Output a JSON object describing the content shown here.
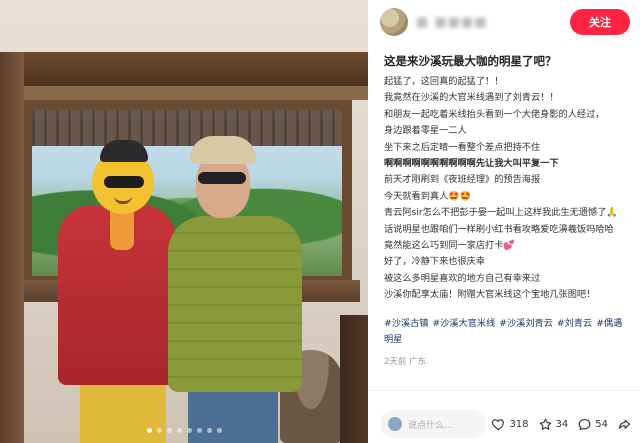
{
  "header": {
    "author_name": "■ ■■■■",
    "follow_label": "关注"
  },
  "post": {
    "title": "这是来沙溪玩最大咖的明星了吧？",
    "lines": [
      "起猛了，这回真的起猛了！！",
      "我竟然在沙溪的大官米线遇到了刘青云！！",
      "和朋友一起吃着米线抬头看到一个大佬身影的人经过，",
      "身边跟着零星一二人",
      "坐下来之后定睛一看整个差点把持不住",
      "啊啊啊啊啊啊啊啊啊啊先让我大叫平复一下",
      "前天才刚刷到《夜班经理》的预告海报",
      "今天就看到真人🤩🤩",
      "青云阿sir怎么不把彭于晏一起叫上这样我此生无遗憾了🙏",
      "话说明星也跟咱们一样刷小红书看攻略爱吃濞羲饭吗哈哈",
      "竟然能这么巧到同一家店打卡💕",
      "好了，冷静下来也很庆幸",
      "被这么多明星喜欢的地方自己有幸来过",
      "沙溪你配享太庙！附赠大官米线这个宝地几张图吧！"
    ],
    "tags": [
      "#沙溪古镇",
      "#沙溪大官米线",
      "#沙溪刘青云",
      "#刘青云",
      "#偶遇明星"
    ],
    "meta": "2天前 广东"
  },
  "footer": {
    "comment_placeholder": "说点什么...",
    "likes": "318",
    "stars": "34",
    "comments": "54"
  },
  "carousel": {
    "count": 8,
    "active_index": 0
  },
  "colors": {
    "accent": "#ff2442",
    "tag": "#13386c"
  }
}
